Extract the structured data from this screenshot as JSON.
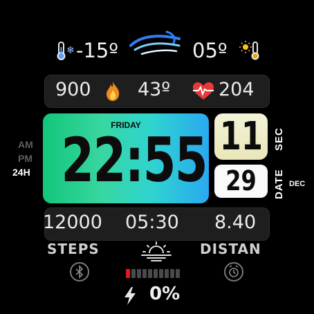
{
  "weather": {
    "temp_low": "-15º",
    "temp_high": "05º"
  },
  "stats": {
    "calories": "900",
    "humidity": "43º",
    "heart_rate": "204"
  },
  "time": {
    "day": "FRIDAY",
    "clock": "22:55",
    "seconds": "11",
    "date": "29",
    "month": "DEC",
    "sec_label": "SEC",
    "date_label": "DATE"
  },
  "format": {
    "am": "AM",
    "pm": "PM",
    "h24": "24H"
  },
  "activity": {
    "steps": "12000",
    "sunrise": "05:30",
    "distance": "8.40",
    "steps_label": "STEPS",
    "distance_label": "DISTAN"
  },
  "battery": {
    "percent_text": "0%",
    "level": 0.0,
    "segments": 10
  },
  "colors": {
    "panel_gradient_start": "#12c67a",
    "panel_gradient_end": "#2aa9f0",
    "battery_red": "#e01b1b",
    "heart_red": "#e8383a",
    "flame_orange": "#f28a1c"
  }
}
